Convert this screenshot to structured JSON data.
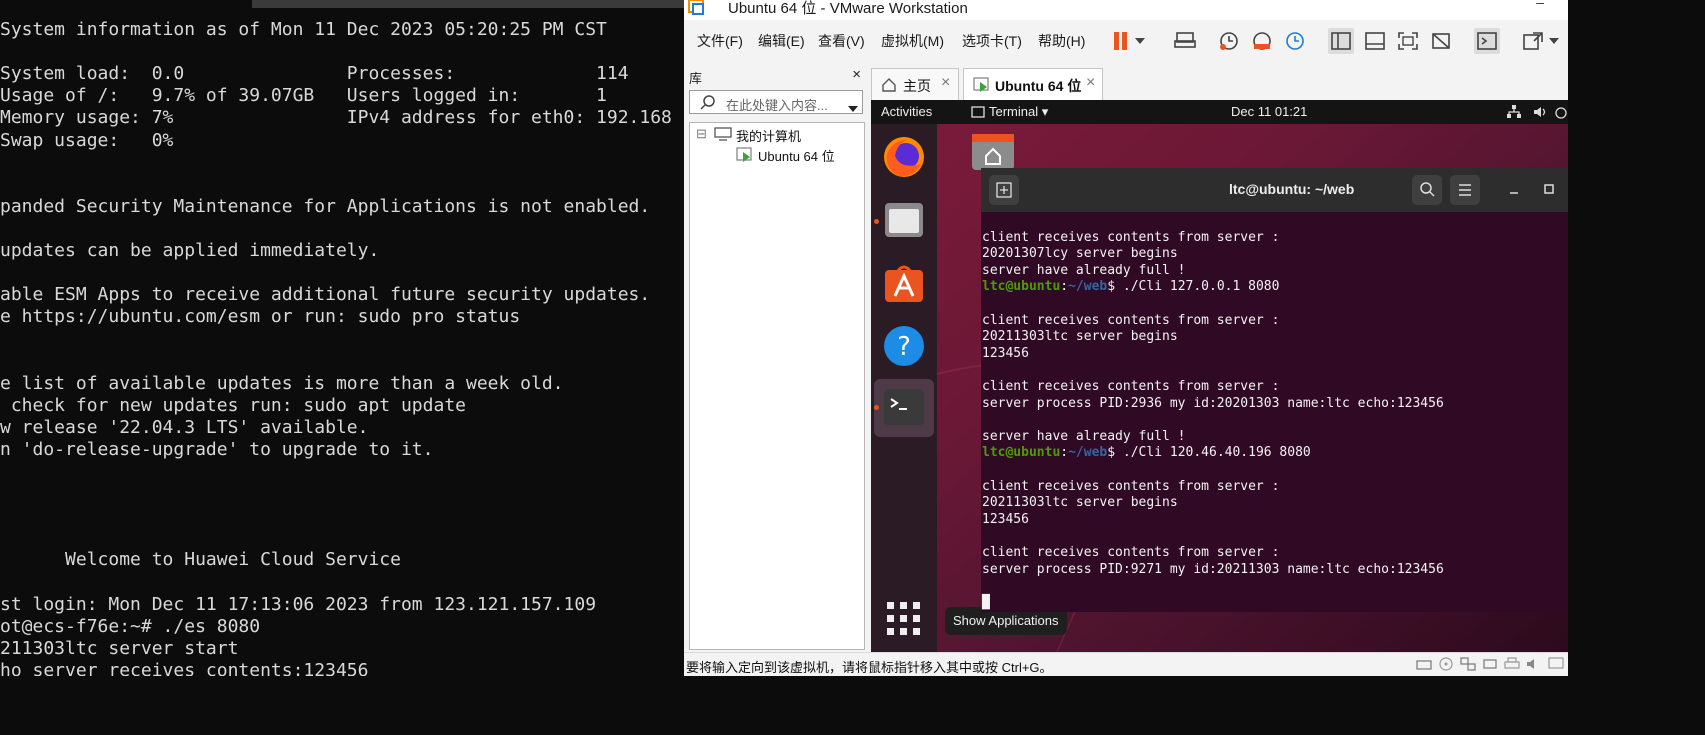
{
  "left_terminal": {
    "lines": [
      "System information as of Mon 11 Dec 2023 05:20:25 PM CST",
      "",
      "System load:  0.0               Processes:             114",
      "Usage of /:   9.7% of 39.07GB   Users logged in:       1",
      "Memory usage: 7%                IPv4 address for eth0: 192.168",
      "Swap usage:   0%",
      "",
      "",
      "panded Security Maintenance for Applications is not enabled.",
      "",
      "updates can be applied immediately.",
      "",
      "able ESM Apps to receive additional future security updates.",
      "e https://ubuntu.com/esm or run: sudo pro status",
      "",
      "",
      "e list of available updates is more than a week old.",
      " check for new updates run: sudo apt update",
      "w release '22.04.3 LTS' available.",
      "n 'do-release-upgrade' to upgrade to it.",
      "",
      "",
      "",
      "",
      "      Welcome to Huawei Cloud Service",
      "",
      "st login: Mon Dec 11 17:13:06 2023 from 123.121.157.109",
      "ot@ecs-f76e:~# ./es 8080",
      "211303ltc server start",
      "ho server receives contents:123456"
    ]
  },
  "vmware": {
    "title": "Ubuntu 64 位 - VMware Workstation",
    "minimize": "–",
    "menu": [
      "文件(F)",
      "编辑(E)",
      "查看(V)",
      "虚拟机(M)",
      "选项卡(T)",
      "帮助(H)"
    ],
    "toolbar_icons": [
      "pause-icon",
      "dropdown-icon",
      "send-ctrl-alt-del-icon",
      "snapshot-icon",
      "revert-snapshot-icon",
      "snapshot-manager-icon",
      "show-library-icon",
      "thumbnail-bar-icon",
      "full-screen-icon",
      "unity-icon",
      "console-view-icon",
      "stretch-icon"
    ],
    "library": {
      "header": "库",
      "close": "×",
      "search_placeholder": "在此处键入内容...",
      "tree": {
        "root": "我的计算机",
        "root_toggle": "⊟",
        "child": "Ubuntu 64 位"
      }
    },
    "tabs": [
      {
        "label": "主页",
        "icon": "home-icon"
      },
      {
        "label": "Ubuntu 64 位",
        "icon": "vm-running-icon"
      }
    ],
    "tab_close": "×",
    "status_message": "要将输入定向到该虚拟机，请将鼠标指针移入其中或按 Ctrl+G。"
  },
  "guest": {
    "top_bar": {
      "activities": "Activities",
      "app_menu": "Terminal ▾",
      "clock": "Dec 11  01:21"
    },
    "dock": [
      "firefox-icon",
      "files-icon",
      "software-icon",
      "help-icon",
      "terminal-icon",
      "show-applications-icon"
    ],
    "tooltip": "Show Applications",
    "terminal": {
      "title": "ltc@ubuntu: ~/web",
      "lines": [
        {
          "text": ""
        },
        {
          "text": "client receives contents from server :"
        },
        {
          "text": "20201307lcy server begins"
        },
        {
          "text": "server have already full !"
        },
        {
          "user": "ltc@ubuntu",
          "path": "~/web",
          "cmd": "$ ./Cli 127.0.0.1 8080"
        },
        {
          "text": ""
        },
        {
          "text": "client receives contents from server :"
        },
        {
          "text": "20211303ltc server begins"
        },
        {
          "text": "123456"
        },
        {
          "text": ""
        },
        {
          "text": "client receives contents from server :"
        },
        {
          "text": "server process PID:2936 my id:20201303 name:ltc echo:123456"
        },
        {
          "text": ""
        },
        {
          "text": "server have already full !"
        },
        {
          "user": "ltc@ubuntu",
          "path": "~/web",
          "cmd": "$ ./Cli 120.46.40.196 8080"
        },
        {
          "text": ""
        },
        {
          "text": "client receives contents from server :"
        },
        {
          "text": "20211303ltc server begins"
        },
        {
          "text": "123456"
        },
        {
          "text": ""
        },
        {
          "text": "client receives contents from server :"
        },
        {
          "text": "server process PID:9271 my id:20211303 name:ltc echo:123456"
        },
        {
          "text": ""
        },
        {
          "text": "█"
        }
      ]
    }
  },
  "colors": {
    "ubuntu_orange": "#e95420",
    "terminal_bg": "#300a24",
    "prompt_user": "#4e9a06",
    "prompt_path": "#3465a4"
  }
}
